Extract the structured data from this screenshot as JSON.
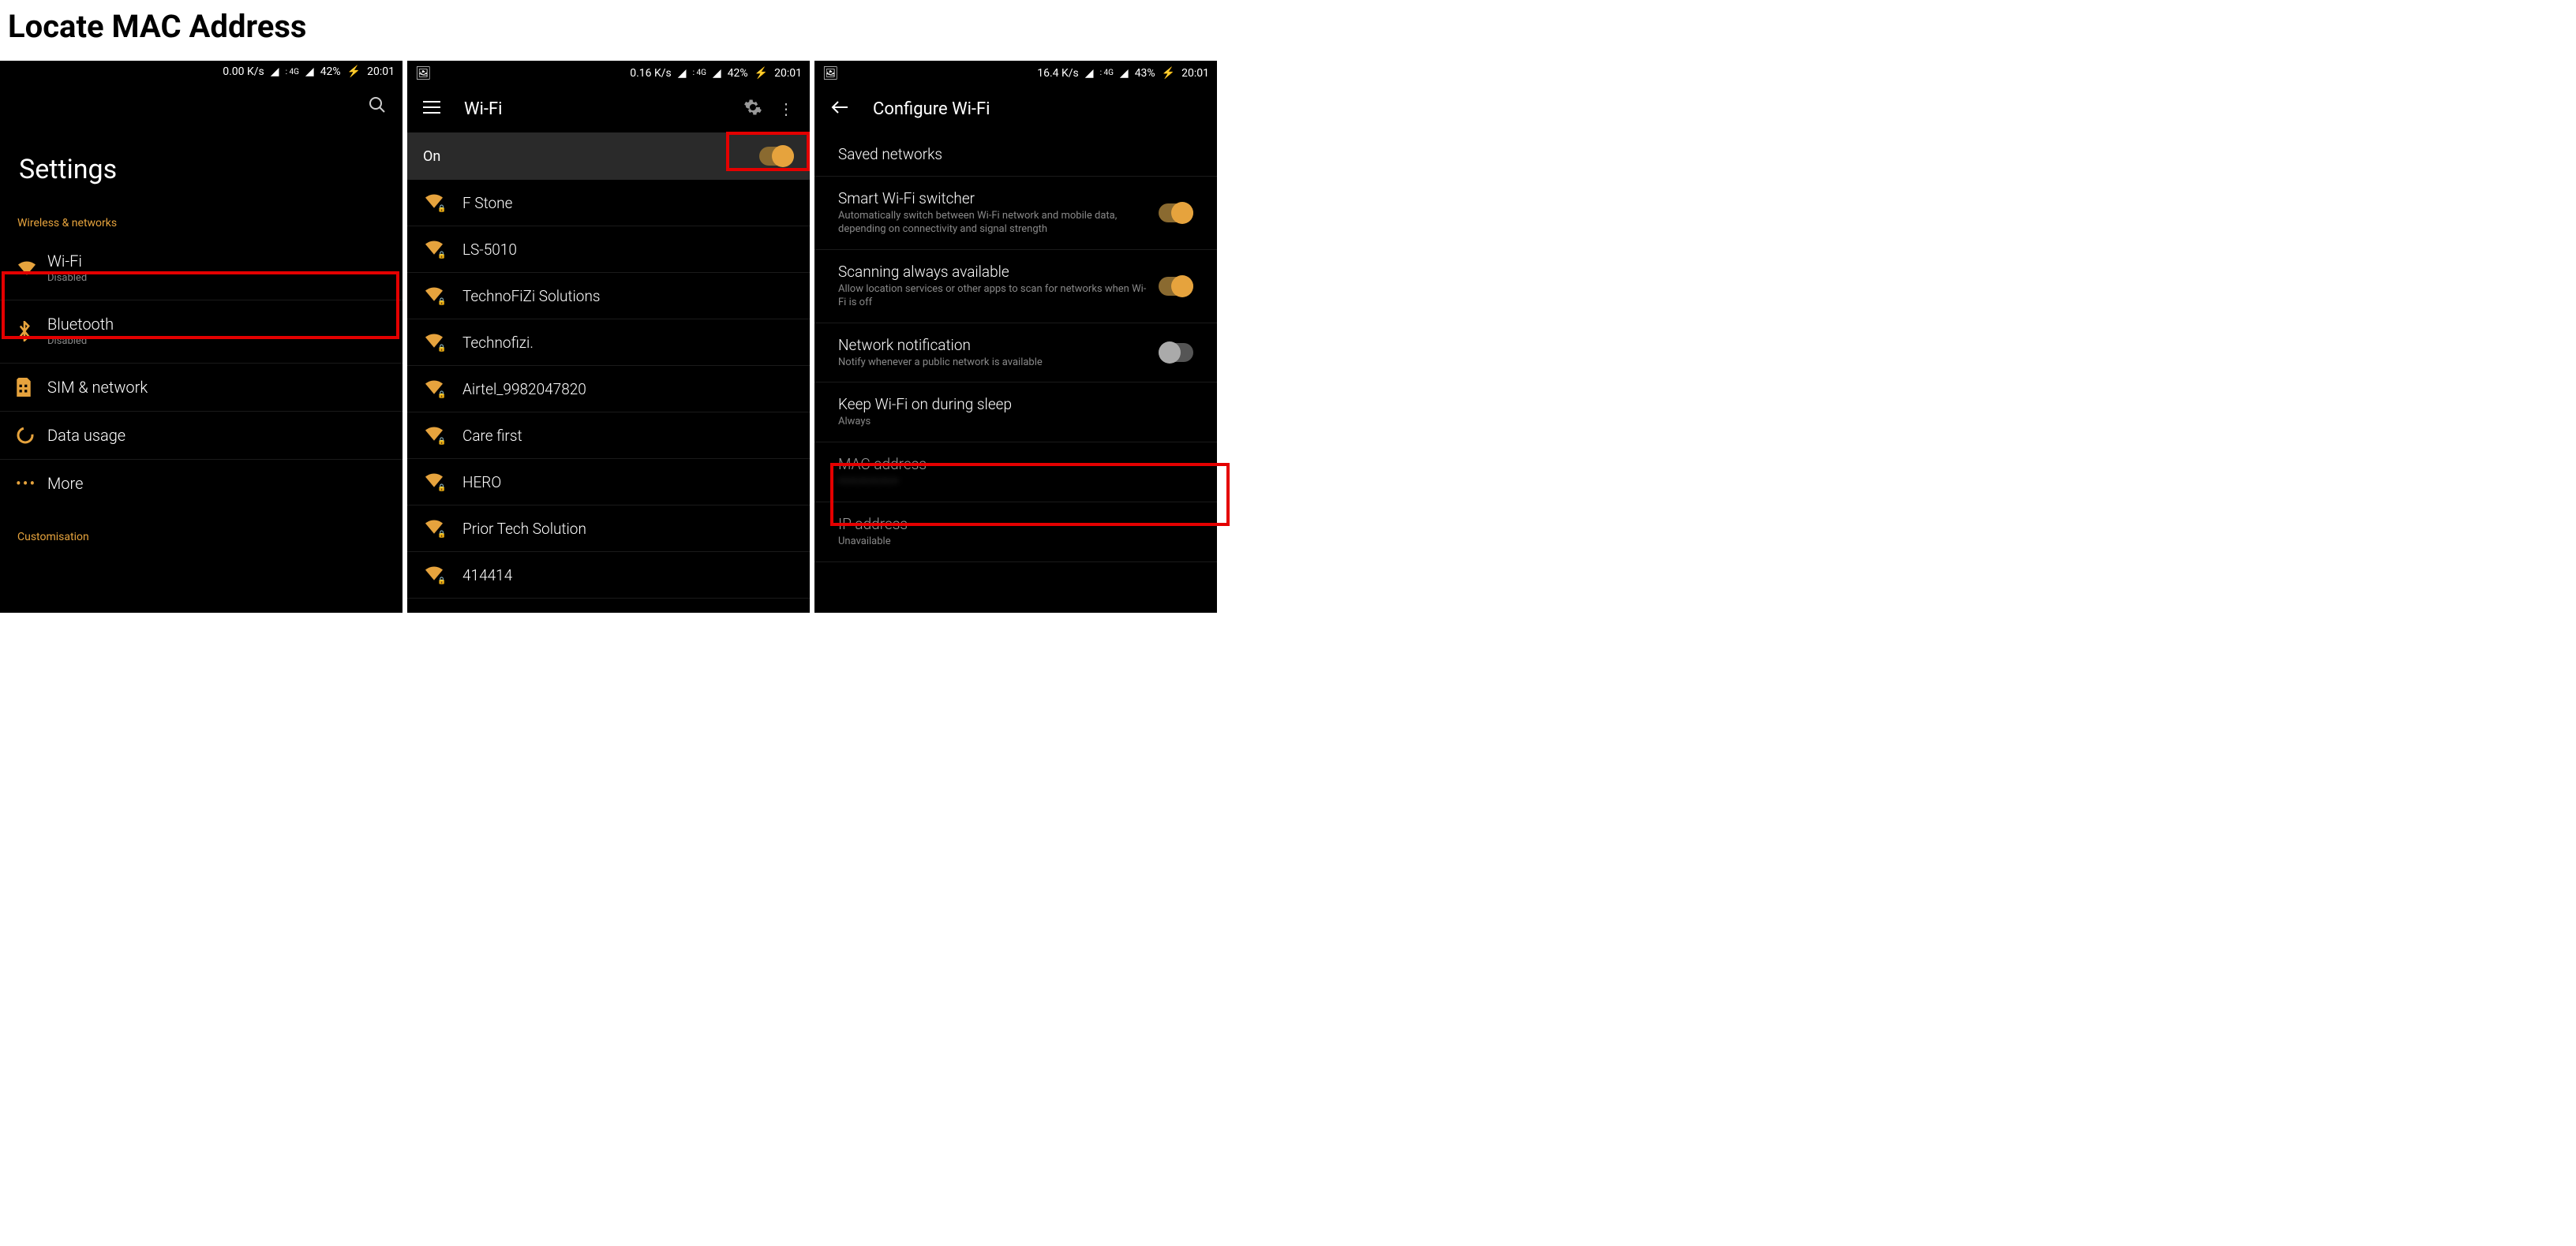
{
  "page_title": "Locate MAC Address",
  "accent_color": "#e6a33d",
  "screen1": {
    "status": {
      "speed": "0.00 K/s",
      "net": "4G",
      "battery": "42%",
      "time": "20:01"
    },
    "title": "Settings",
    "section1": "Wireless & networks",
    "items": [
      {
        "label": "Wi-Fi",
        "sub": "Disabled",
        "icon": "wifi"
      },
      {
        "label": "Bluetooth",
        "sub": "Disabled",
        "icon": "bluetooth"
      },
      {
        "label": "SIM & network",
        "sub": "",
        "icon": "sim"
      },
      {
        "label": "Data usage",
        "sub": "",
        "icon": "data"
      },
      {
        "label": "More",
        "sub": "",
        "icon": "more"
      }
    ],
    "section2": "Customisation"
  },
  "screen2": {
    "status": {
      "speed": "0.16 K/s",
      "net": "4G",
      "battery": "42%",
      "time": "20:01"
    },
    "title": "Wi-Fi",
    "toggle_label": "On",
    "toggle_state": true,
    "networks": [
      "F Stone",
      "LS-5010",
      "TechnoFiZi Solutions",
      "Technofizi.",
      "Airtel_9982047820",
      "Care first",
      "HERO",
      "Prior Tech Solution",
      "414414"
    ]
  },
  "screen3": {
    "status": {
      "speed": "16.4 K/s",
      "net": "4G",
      "battery": "43%",
      "time": "20:01"
    },
    "title": "Configure Wi-Fi",
    "items": [
      {
        "label": "Saved networks",
        "sub": ""
      },
      {
        "label": "Smart Wi-Fi switcher",
        "sub": "Automatically switch between Wi-Fi network and mobile data, depending on connectivity and signal strength",
        "toggle": true,
        "on": true
      },
      {
        "label": "Scanning always available",
        "sub": "Allow location services or other apps to scan for networks when Wi-Fi is off",
        "toggle": true,
        "on": true
      },
      {
        "label": "Network notification",
        "sub": "Notify whenever a public network is available",
        "toggle": true,
        "on": false
      },
      {
        "label": "Keep Wi-Fi on during sleep",
        "sub": "Always"
      },
      {
        "label": "MAC address",
        "sub": "—:—:—:—:—:—",
        "blurred": true
      },
      {
        "label": "IP address",
        "sub": "Unavailable"
      }
    ]
  }
}
